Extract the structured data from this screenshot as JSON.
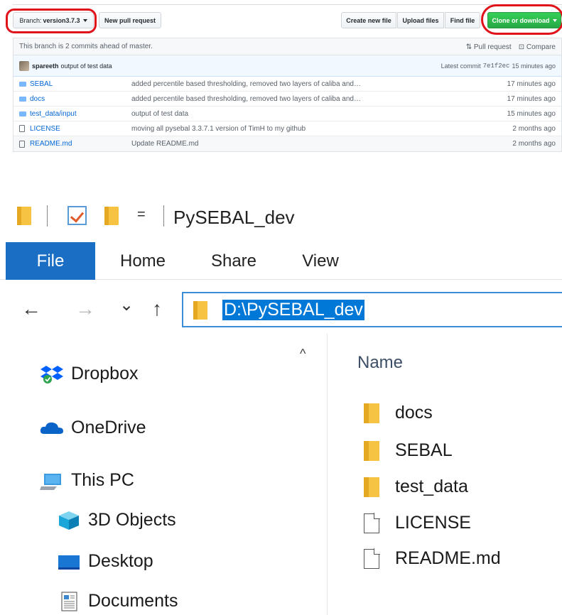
{
  "github": {
    "branch_label": "Branch:",
    "branch_value": "version3.7.3",
    "new_pull_request": "New pull request",
    "create_new_file": "Create new file",
    "upload_files": "Upload files",
    "find_file": "Find file",
    "clone_or_download": "Clone or download",
    "ahead_text": "This branch is 2 commits ahead of master.",
    "pull_request_link": "Pull request",
    "compare_link": "Compare",
    "commit": {
      "author": "spareeth",
      "message": "output of test data",
      "latest_label": "Latest commit",
      "sha": "7e1f2ec",
      "age": "15 minutes ago"
    },
    "files": [
      {
        "name": "SEBAL",
        "name_suffix": "",
        "type": "dir",
        "message": "added percentile based thresholding, removed two layers of caliba and…",
        "age": "17 minutes ago"
      },
      {
        "name": "docs",
        "name_suffix": "",
        "type": "dir",
        "message": "added percentile based thresholding, removed two layers of caliba and…",
        "age": "17 minutes ago"
      },
      {
        "name": "test_data/",
        "name_suffix": "input",
        "type": "dir",
        "message": "output of test data",
        "age": "15 minutes ago"
      },
      {
        "name": "LICENSE",
        "name_suffix": "",
        "type": "file",
        "message": "moving all pysebal 3.3.7.1 version of TimH to my github",
        "age": "2 months ago"
      },
      {
        "name": "README.md",
        "name_suffix": "",
        "type": "file",
        "message": "Update README.md",
        "age": "2 months ago"
      }
    ]
  },
  "explorer": {
    "window_title": "PySEBAL_dev",
    "qat_dropdown": "=",
    "tabs": {
      "file": "File",
      "home": "Home",
      "share": "Share",
      "view": "View"
    },
    "nav": {
      "back": "←",
      "forward": "→",
      "recent": "⌄",
      "up": "↑"
    },
    "address": "D:\\PySEBAL_dev",
    "scroll_up": "^",
    "nav_pane": {
      "dropbox": "Dropbox",
      "onedrive": "OneDrive",
      "this_pc": "This PC",
      "objects3d": "3D Objects",
      "desktop": "Desktop",
      "documents": "Documents"
    },
    "column_name": "Name",
    "files": [
      {
        "name": "docs",
        "type": "folder"
      },
      {
        "name": "SEBAL",
        "type": "folder"
      },
      {
        "name": "test_data",
        "type": "folder"
      },
      {
        "name": "LICENSE",
        "type": "file"
      },
      {
        "name": "README.md",
        "type": "file"
      }
    ]
  },
  "colors": {
    "github_blue": "#0366d6",
    "clone_green": "#28a745",
    "annotation_red": "#e0131a",
    "file_tab_blue": "#1a6fc4",
    "selection_blue": "#0078d7",
    "folder_yellow": "#f6c343"
  },
  "icons": {
    "dir": "folder-icon",
    "file": "file-icon",
    "dropbox": "dropbox-icon",
    "onedrive": "cloud-icon",
    "this_pc": "computer-icon",
    "objects3d": "cube-icon",
    "desktop": "monitor-icon",
    "documents": "documents-icon"
  }
}
